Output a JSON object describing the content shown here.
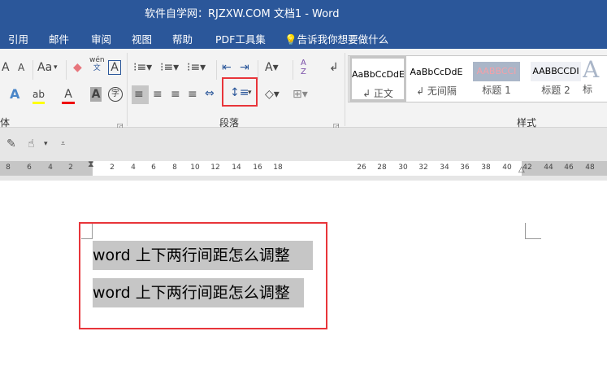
{
  "title": "软件自学网：RJZXW.COM  文档1  -  Word",
  "tabs": [
    "引用",
    "邮件",
    "审阅",
    "视图",
    "帮助",
    "PDF工具集"
  ],
  "tell_me": "告诉我你想要做什么",
  "groups": {
    "font": "体",
    "paragraph": "段落",
    "styles": "样式"
  },
  "font_icons": {
    "grow": "A",
    "aa": "Aa",
    "phonetic_top": "wén",
    "phonetic_bottom": "文",
    "border_char": "A",
    "text_effect": "A",
    "highlight": "ab",
    "font_color": "A",
    "shading": "A",
    "enclosed": "字"
  },
  "styles": [
    {
      "preview": "AaBbCcDdE",
      "name": "↲ 正文"
    },
    {
      "preview": "AaBbCcDdE",
      "name": "↲ 无间隔"
    },
    {
      "preview": "AABBCCI",
      "name": "标题 1"
    },
    {
      "preview": "AABBCCDI",
      "name": "标题 2"
    },
    {
      "preview": "A",
      "name": "标"
    }
  ],
  "ruler": {
    "left": [
      "8",
      "6",
      "4",
      "2"
    ],
    "right_a": [
      "2",
      "4",
      "6",
      "8",
      "10",
      "12",
      "14",
      "16",
      "18"
    ],
    "right_b": [
      "26",
      "28",
      "30",
      "32",
      "34",
      "36",
      "38",
      "40",
      "42",
      "44",
      "46",
      "48"
    ]
  },
  "document": {
    "lines": [
      "word 上下两行间距怎么调整",
      "word 上下两行间距怎么调整"
    ]
  },
  "colors": {
    "accent": "#2b579a",
    "highlight_box": "#e8353a",
    "selection": "#c6c6c6"
  }
}
